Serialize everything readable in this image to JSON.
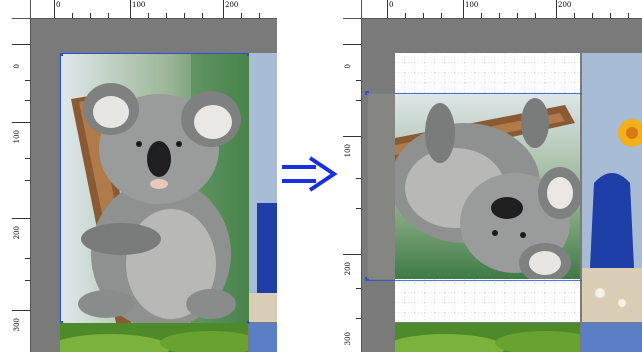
{
  "ruler": {
    "h_labels": [
      "0",
      "100",
      "200"
    ],
    "v_labels": [
      "0",
      "100",
      "200",
      "300"
    ]
  },
  "arrow": {
    "glyph": "⇒",
    "color": "#1a2fe0"
  },
  "colors": {
    "canvas": "#7a7a7a",
    "selection": "#2b4fd6"
  }
}
